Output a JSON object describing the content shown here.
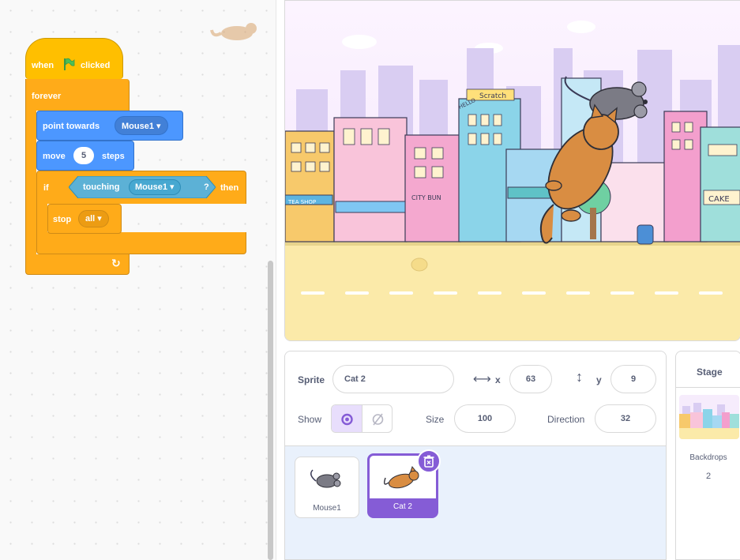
{
  "colors": {
    "events": "#ffbf00",
    "control": "#ffab19",
    "motion": "#4c97ff",
    "sensing": "#5cb1d6",
    "selected": "#855cd6",
    "text": "#575e75"
  },
  "code": {
    "hat": {
      "when": "when",
      "clicked": "clicked",
      "icon": "green-flag-icon"
    },
    "forever": {
      "label": "forever",
      "icon": "loop-arrow-icon"
    },
    "point_towards": {
      "label": "point towards",
      "target": "Mouse1 ▾"
    },
    "move": {
      "label": "move",
      "steps": "5",
      "unit": "steps"
    },
    "if_block": {
      "if": "if",
      "then": "then",
      "touching": "touching",
      "target": "Mouse1 ▾",
      "question": "?"
    },
    "stop": {
      "label": "stop",
      "option": "all ▾"
    }
  },
  "stage_scene": {
    "signs": {
      "scratch": "Scratch",
      "hello": "HELLO",
      "tea_shop": "TEA SHOP",
      "city_bun": "CITY BUN",
      "cake": "CAKE"
    }
  },
  "sprite_info": {
    "sprite_label": "Sprite",
    "sprite_name": "Cat 2",
    "x_label": "x",
    "x": "63",
    "y_label": "y",
    "y": "9",
    "show_label": "Show",
    "size_label": "Size",
    "size": "100",
    "direction_label": "Direction",
    "direction": "32"
  },
  "sprites": [
    {
      "name": "Mouse1",
      "selected": false
    },
    {
      "name": "Cat 2",
      "selected": true
    }
  ],
  "stage_pane": {
    "title": "Stage",
    "backdrops_label": "Backdrops",
    "backdrops_count": "2"
  }
}
